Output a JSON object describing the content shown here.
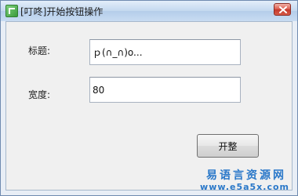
{
  "window": {
    "title": "[叮咚]开始按钮操作"
  },
  "form": {
    "title_label": "标题:",
    "title_value": "ｐ(∩_∩)o...",
    "width_label": "宽度:",
    "width_value": "80",
    "start_button": "开整"
  },
  "watermark": {
    "cn": "易语言资源网",
    "en": "www.e5a5x.com"
  },
  "icons": {
    "app": "app-icon",
    "close": "close-icon"
  },
  "colors": {
    "close_button": "#c4382b",
    "watermark": "#2a78c9"
  }
}
